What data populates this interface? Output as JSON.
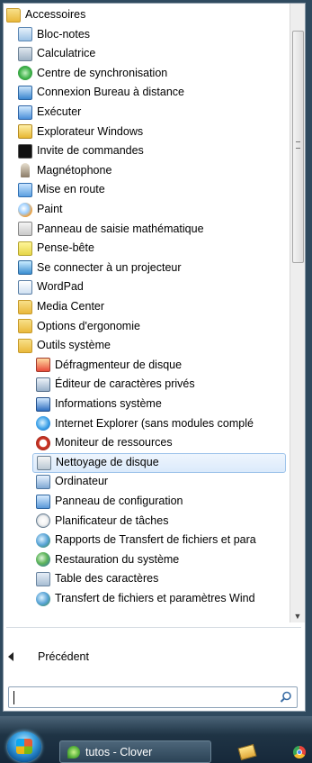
{
  "start_menu": {
    "items": [
      {
        "label": "Accessoires",
        "icon": "folder-icon",
        "cls": "folder",
        "level": 0
      },
      {
        "label": "Bloc-notes",
        "icon": "notepad-icon",
        "cls": "notepad",
        "level": 1
      },
      {
        "label": "Calculatrice",
        "icon": "calculator-icon",
        "cls": "calc",
        "level": 1
      },
      {
        "label": "Centre de synchronisation",
        "icon": "sync-center-icon",
        "cls": "sync",
        "level": 1
      },
      {
        "label": "Connexion Bureau à distance",
        "icon": "remote-desktop-icon",
        "cls": "remote",
        "level": 1
      },
      {
        "label": "Exécuter",
        "icon": "run-icon",
        "cls": "run",
        "level": 1
      },
      {
        "label": "Explorateur Windows",
        "icon": "windows-explorer-icon",
        "cls": "explorer",
        "level": 1
      },
      {
        "label": "Invite de commandes",
        "icon": "command-prompt-icon",
        "cls": "cmd",
        "level": 1
      },
      {
        "label": "Magnétophone",
        "icon": "microphone-icon",
        "cls": "mic",
        "level": 1
      },
      {
        "label": "Mise en route",
        "icon": "getting-started-icon",
        "cls": "mobility",
        "level": 1
      },
      {
        "label": "Paint",
        "icon": "paint-palette-icon",
        "cls": "paint",
        "level": 1
      },
      {
        "label": "Panneau de saisie mathématique",
        "icon": "math-input-icon",
        "cls": "math",
        "level": 1
      },
      {
        "label": "Pense-bête",
        "icon": "sticky-notes-icon",
        "cls": "sticky",
        "level": 1
      },
      {
        "label": "Se connecter à un projecteur",
        "icon": "projector-icon",
        "cls": "proj",
        "level": 1
      },
      {
        "label": "WordPad",
        "icon": "wordpad-icon",
        "cls": "wordpad",
        "level": 1
      },
      {
        "label": "Media Center",
        "icon": "folder-icon",
        "cls": "folder",
        "level": 1
      },
      {
        "label": "Options d'ergonomie",
        "icon": "folder-icon",
        "cls": "folder",
        "level": 1
      },
      {
        "label": "Outils système",
        "icon": "folder-icon",
        "cls": "folder",
        "level": 1
      },
      {
        "label": "Défragmenteur de disque",
        "icon": "defragmenter-icon",
        "cls": "defrag",
        "level": 2
      },
      {
        "label": "Éditeur de caractères privés",
        "icon": "character-editor-icon",
        "cls": "charedit",
        "level": 2
      },
      {
        "label": "Informations système",
        "icon": "system-information-icon",
        "cls": "sysinfo",
        "level": 2
      },
      {
        "label": "Internet Explorer (sans modules complé",
        "icon": "internet-explorer-icon",
        "cls": "ie",
        "level": 2
      },
      {
        "label": "Moniteur de ressources",
        "icon": "resource-monitor-icon",
        "cls": "resmon",
        "level": 2
      },
      {
        "label": "Nettoyage de disque",
        "icon": "disk-cleanup-icon",
        "cls": "cleanup",
        "level": 2,
        "selected": true
      },
      {
        "label": "Ordinateur",
        "icon": "computer-icon",
        "cls": "computer",
        "level": 2
      },
      {
        "label": "Panneau de configuration",
        "icon": "control-panel-icon",
        "cls": "control",
        "level": 2
      },
      {
        "label": "Planificateur de tâches",
        "icon": "task-scheduler-icon",
        "cls": "scheduler",
        "level": 2
      },
      {
        "label": "Rapports de Transfert de fichiers et para",
        "icon": "transfer-reports-icon",
        "cls": "transfer",
        "level": 2
      },
      {
        "label": "Restauration du système",
        "icon": "system-restore-icon",
        "cls": "restore",
        "level": 2
      },
      {
        "label": "Table des caractères",
        "icon": "character-map-icon",
        "cls": "charmap",
        "level": 2
      },
      {
        "label": "Transfert de fichiers et paramètres Wind",
        "icon": "easy-transfer-icon",
        "cls": "transfer",
        "level": 2
      }
    ],
    "back_label": "Précédent",
    "search": {
      "value": "",
      "placeholder": ""
    }
  },
  "taskbar": {
    "task_label": "tutos - Clover"
  }
}
